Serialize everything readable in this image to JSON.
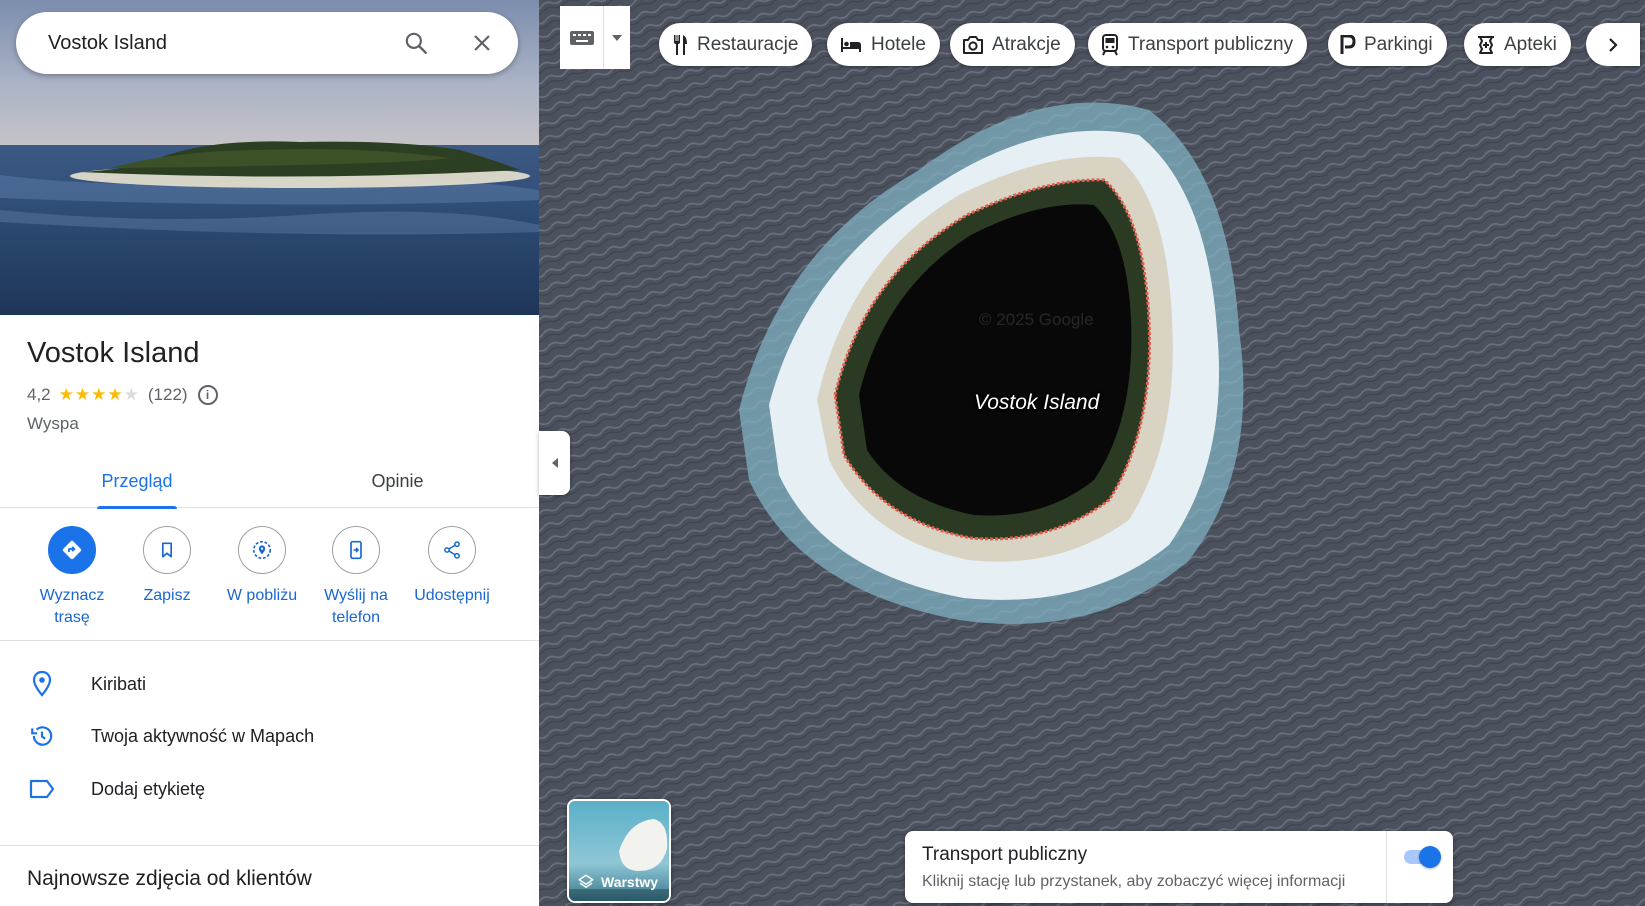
{
  "search": {
    "query": "Vostok Island"
  },
  "place": {
    "title": "Vostok Island",
    "rating": "4,2",
    "stars_value": 4.2,
    "stars_max": 5,
    "reviews": "(122)",
    "category": "Wyspa"
  },
  "tabs": [
    {
      "label": "Przegląd",
      "active": true
    },
    {
      "label": "Opinie",
      "active": false
    }
  ],
  "actions": [
    {
      "label_line1": "Wyznacz",
      "label_line2": "trasę",
      "icon": "directions-icon"
    },
    {
      "label_line1": "Zapisz",
      "label_line2": "",
      "icon": "bookmark-icon"
    },
    {
      "label_line1": "W pobliżu",
      "label_line2": "",
      "icon": "nearby-icon"
    },
    {
      "label_line1": "Wyślij na",
      "label_line2": "telefon",
      "icon": "send-to-phone-icon"
    },
    {
      "label_line1": "Udostępnij",
      "label_line2": "",
      "icon": "share-icon"
    }
  ],
  "info": [
    {
      "text": "Kiribati",
      "icon": "location-pin-icon"
    },
    {
      "text": "Twoja aktywność w Mapach",
      "icon": "history-icon"
    },
    {
      "text": "Dodaj etykietę",
      "icon": "label-icon"
    }
  ],
  "recent_photos_title": "Najnowsze zdjęcia od klientów",
  "chips": [
    {
      "label": "Restauracje",
      "icon": "restaurant-icon"
    },
    {
      "label": "Hotele",
      "icon": "hotel-icon"
    },
    {
      "label": "Atrakcje",
      "icon": "camera-icon"
    },
    {
      "label": "Transport publiczny",
      "icon": "transit-icon"
    },
    {
      "label": "Parkingi",
      "icon": "parking-icon"
    },
    {
      "label": "Apteki",
      "icon": "pharmacy-icon"
    }
  ],
  "map": {
    "island_label": "Vostok Island",
    "layers_label": "Warstwy"
  },
  "transit_panel": {
    "title": "Transport publiczny",
    "subtitle": "Kliknij stację lub przystanek, aby zobaczyć więcej informacji",
    "toggle_on": true
  },
  "colors": {
    "accent": "#1a73e8",
    "star": "#fbbc04",
    "boundary": "#e06050"
  }
}
